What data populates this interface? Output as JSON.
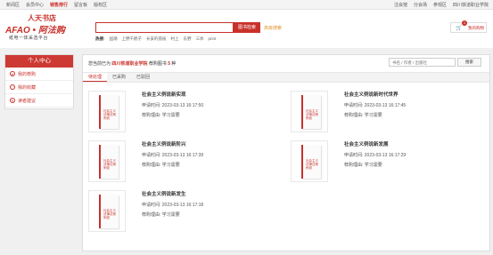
{
  "topbar": {
    "left": [
      "新闻区",
      "会员中心",
      "销售排行",
      "留言板",
      "版权区"
    ],
    "active_index": 2,
    "right": [
      "注会馆",
      "分会场",
      "参观区",
      "四川铁道职业学院"
    ]
  },
  "logo": {
    "line1": "人天书店",
    "line2": "AFAO • 阿法购",
    "line3": "纸电一体采选平台"
  },
  "search": {
    "placeholder": "",
    "button_label": "图书检索",
    "advanced_label": "高级搜索",
    "hot_label": "热搜:",
    "hot_words": [
      "国潮",
      "上野千鹤子",
      "长安的荔枝",
      "村上",
      "东野",
      "三体",
      "print"
    ]
  },
  "cart": {
    "icon": "cart-icon",
    "count": "1",
    "label": "我的购物"
  },
  "sidebar": {
    "title": "个人中心",
    "items": [
      {
        "label": "我的荐购",
        "icon": "cart-icon"
      },
      {
        "label": "我的收藏",
        "icon": "heart-icon"
      },
      {
        "label": "读者建议",
        "icon": "message-icon"
      }
    ]
  },
  "main": {
    "summary_prefix": "您当前已为",
    "summary_school": "四川铁道职业学院",
    "summary_mid": "荐购图书",
    "summary_count": "5",
    "summary_suffix": "种",
    "search_placeholder": "书名 / 作者 / 出版社",
    "search_button": "搜索",
    "tabs": [
      "待处理",
      "已采购",
      "已驳回"
    ],
    "active_tab": 0,
    "apply_label": "申请时间:",
    "reason_label": "荐购理由:",
    "cover_text": "社会主义 法律法规 例说",
    "books": [
      {
        "title": "社会主义例说新实现",
        "time": "2023-03-13 16:17:50",
        "reason": "学习需要"
      },
      {
        "title": "社会主义例说新时代世界",
        "time": "2023-03-13 16:17:45",
        "reason": "学习需要"
      },
      {
        "title": "社会主义例说新阶兴",
        "time": "2023-03-13 16:17:39",
        "reason": "学习需要"
      },
      {
        "title": "社会主义例说新发展",
        "time": "2023-03-13 16:17:29",
        "reason": "学习需要"
      },
      {
        "title": "社会主义例说新发生",
        "time": "2023-03-13 16:17:18",
        "reason": "学习需要"
      }
    ]
  }
}
